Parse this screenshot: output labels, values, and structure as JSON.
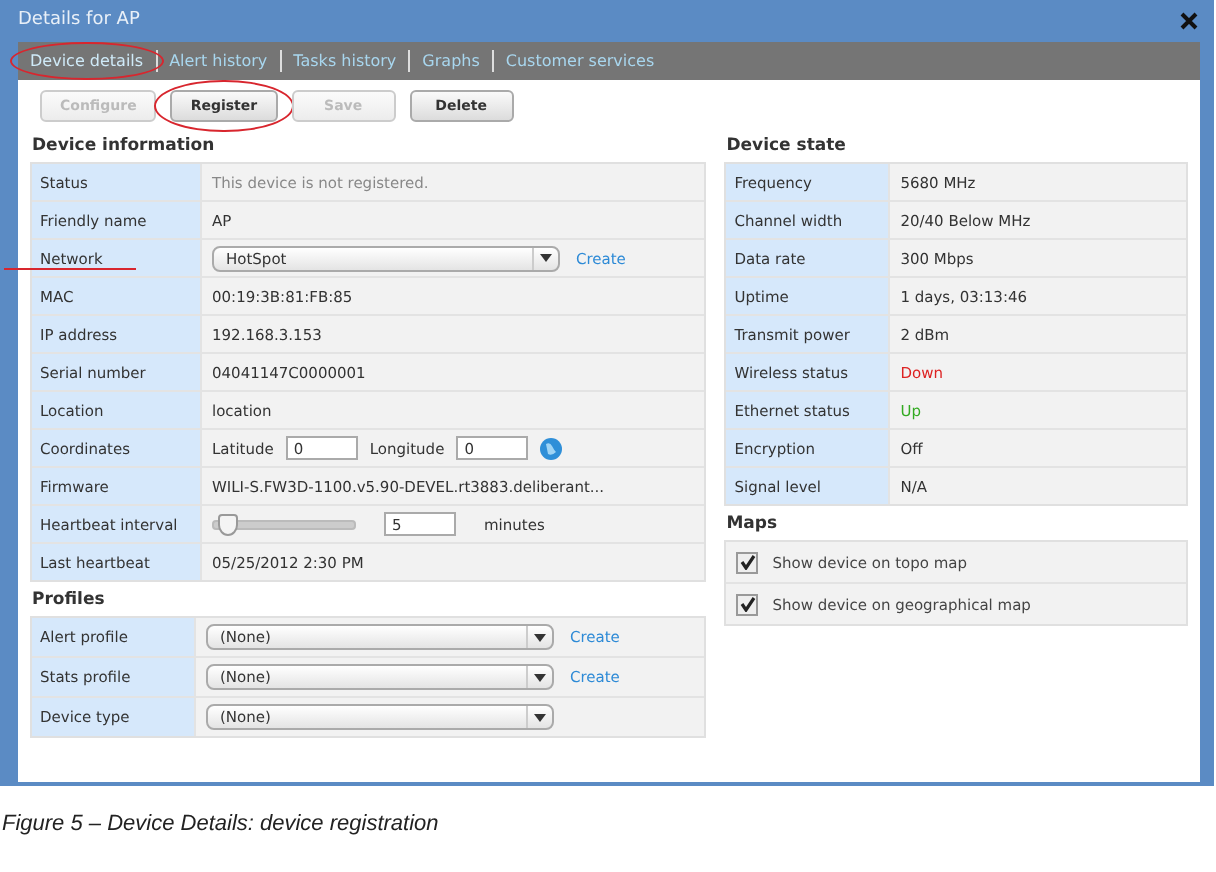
{
  "window": {
    "title": "Details for AP"
  },
  "tabs": [
    {
      "label": "Device details",
      "selected": true,
      "circled": true
    },
    {
      "label": "Alert history",
      "selected": false,
      "circled": false
    },
    {
      "label": "Tasks history",
      "selected": false,
      "circled": false
    },
    {
      "label": "Graphs",
      "selected": false,
      "circled": false
    },
    {
      "label": "Customer services",
      "selected": false,
      "circled": false
    }
  ],
  "buttons": [
    {
      "label": "Configure",
      "disabled": true,
      "circled": false
    },
    {
      "label": "Register",
      "disabled": false,
      "circled": true
    },
    {
      "label": "Save",
      "disabled": true,
      "circled": false
    },
    {
      "label": "Delete",
      "disabled": false,
      "circled": false
    }
  ],
  "device_information": {
    "heading": "Device information",
    "rows": [
      {
        "kind": "note",
        "label": "Status",
        "value": "This device is not registered.",
        "underlined": false
      },
      {
        "kind": "text",
        "label": "Friendly name",
        "value": "AP",
        "underlined": false
      },
      {
        "kind": "select",
        "label": "Network",
        "value": "HotSpot",
        "link": "Create",
        "underlined": true
      },
      {
        "kind": "text",
        "label": "MAC",
        "value": "00:19:3B:81:FB:85",
        "underlined": false
      },
      {
        "kind": "text",
        "label": "IP address",
        "value": "192.168.3.153",
        "underlined": false
      },
      {
        "kind": "text",
        "label": "Serial number",
        "value": "04041147C0000001",
        "underlined": false
      },
      {
        "kind": "text",
        "label": "Location",
        "value": "location",
        "underlined": false
      },
      {
        "kind": "coords",
        "label": "Coordinates",
        "lat_label": "Latitude",
        "lat": "0",
        "lon_label": "Longitude",
        "lon": "0",
        "underlined": false
      },
      {
        "kind": "text",
        "label": "Firmware",
        "value": "WILI-S.FW3D-1100.v5.90-DEVEL.rt3883.deliberant...",
        "underlined": false
      },
      {
        "kind": "slider",
        "label": "Heartbeat interval",
        "level": 0.05,
        "value": "5",
        "unit": "minutes",
        "underlined": false
      },
      {
        "kind": "text",
        "label": "Last heartbeat",
        "value": "05/25/2012 2:30 PM",
        "underlined": false
      }
    ]
  },
  "profiles": {
    "heading": "Profiles",
    "rows": [
      {
        "kind": "select",
        "label": "Alert profile",
        "value": "(None)",
        "link": "Create"
      },
      {
        "kind": "select",
        "label": "Stats profile",
        "value": "(None)",
        "link": "Create"
      },
      {
        "kind": "select",
        "label": "Device type",
        "value": "(None)"
      }
    ]
  },
  "device_state": {
    "heading": "Device state",
    "rows": [
      {
        "label": "Frequency",
        "value": "5680 MHz"
      },
      {
        "label": "Channel width",
        "value": "20/40 Below MHz"
      },
      {
        "label": "Data rate",
        "value": "300 Mbps"
      },
      {
        "label": "Uptime",
        "value": "1 days, 03:13:46"
      },
      {
        "label": "Transmit power",
        "value": "2 dBm"
      },
      {
        "label": "Wireless status",
        "value": "Down",
        "color": "#dd2222"
      },
      {
        "label": "Ethernet status",
        "value": "Up",
        "color": "#33aa22"
      },
      {
        "label": "Encryption",
        "value": "Off"
      },
      {
        "label": "Signal level",
        "value": "N/A"
      }
    ]
  },
  "maps": {
    "heading": "Maps",
    "items": [
      {
        "label": "Show device on topo map",
        "checked": true
      },
      {
        "label": "Show device on geographical map",
        "checked": true
      }
    ]
  },
  "caption": "Figure 5 – Device Details: device registration"
}
